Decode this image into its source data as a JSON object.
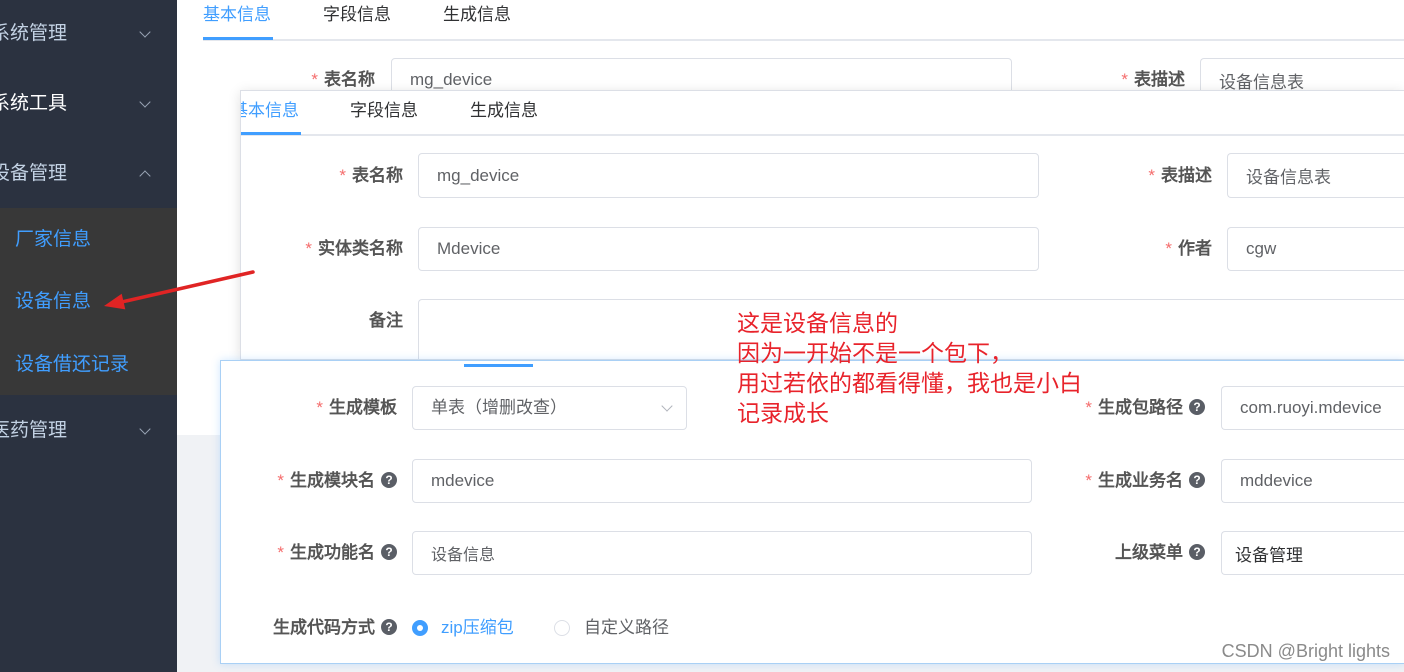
{
  "sidebar": {
    "menus": [
      {
        "label": "系统管理",
        "icon": "chevron-down-icon"
      },
      {
        "label": "系统工具",
        "icon": "chevron-down-icon"
      },
      {
        "label": "设备管理",
        "icon": "chevron-up-icon",
        "expanded": true
      },
      {
        "label": "医药管理",
        "icon": "chevron-down-icon"
      }
    ],
    "submenu": [
      {
        "label": "厂家信息"
      },
      {
        "label": "设备信息"
      },
      {
        "label": "设备借还记录"
      }
    ]
  },
  "required_mark": "*",
  "back_panel": {
    "tabs": [
      {
        "label": "基本信息",
        "active": true
      },
      {
        "label": "字段信息"
      },
      {
        "label": "生成信息"
      }
    ],
    "fields": [
      {
        "label": "表名称",
        "required": true,
        "value": "mg_device"
      },
      {
        "label": "表描述",
        "required": true,
        "value": "设备信息表"
      }
    ]
  },
  "basic_panel": {
    "tabs": [
      {
        "label": "基本信息",
        "active": true
      },
      {
        "label": "字段信息"
      },
      {
        "label": "生成信息"
      }
    ],
    "fields": [
      {
        "label": "表名称",
        "required": true,
        "value": "mg_device"
      },
      {
        "label": "表描述",
        "required": true,
        "value": "设备信息表"
      },
      {
        "label": "实体类名称",
        "required": true,
        "value": "Mdevice"
      },
      {
        "label": "作者",
        "required": true,
        "value": "cgw"
      },
      {
        "label": "备注",
        "required": false
      }
    ]
  },
  "gen_panel": {
    "fields": [
      {
        "label": "生成模板",
        "required": true,
        "value": "单表（增删改查）"
      },
      {
        "label": "生成包路径",
        "required": true,
        "help": true,
        "value": "com.ruoyi.mdevice"
      },
      {
        "label": "生成模块名",
        "required": true,
        "help": true,
        "value": "mdevice"
      },
      {
        "label": "生成业务名",
        "required": true,
        "help": true,
        "value": "mddevice"
      },
      {
        "label": "生成功能名",
        "required": true,
        "help": true,
        "value": "设备信息"
      },
      {
        "label": "上级菜单",
        "required": false,
        "help": true,
        "value": "设备管理"
      }
    ],
    "gen_type": {
      "label": "生成代码方式",
      "help": true,
      "options": [
        {
          "label": "zip压缩包",
          "checked": true
        },
        {
          "label": "自定义路径",
          "checked": false
        }
      ]
    }
  },
  "annotation": {
    "lines": [
      "这是设备信息的",
      "因为一开始不是一个包下，",
      "用过若依的都看得懂，我也是小白",
      "记录成长"
    ],
    "color": "#e8232b"
  },
  "watermark": "CSDN @Bright lights",
  "colors": {
    "primary": "#409eff",
    "sidebar_bg": "#2b3240",
    "submenu_bg": "#383838",
    "required": "#f56c6c",
    "annotation": "#e8232b"
  }
}
